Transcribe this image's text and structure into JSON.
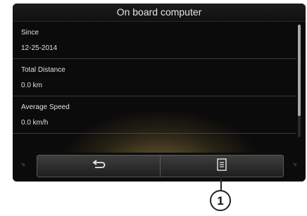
{
  "header": {
    "title": "On board computer"
  },
  "rows": [
    {
      "label": "Since",
      "value": "12-25-2014"
    },
    {
      "label": "Total Distance",
      "value": "0.0 km"
    },
    {
      "label": "Average Speed",
      "value": "0.0 km/h"
    }
  ],
  "bottom_bar": {
    "left_temp": "°c",
    "right_temp": "°c",
    "back_icon": "back-arrow-icon",
    "menu_icon": "menu-list-icon"
  },
  "callout": {
    "number": "1"
  },
  "scroll": {
    "visible_fraction": 0.8
  }
}
